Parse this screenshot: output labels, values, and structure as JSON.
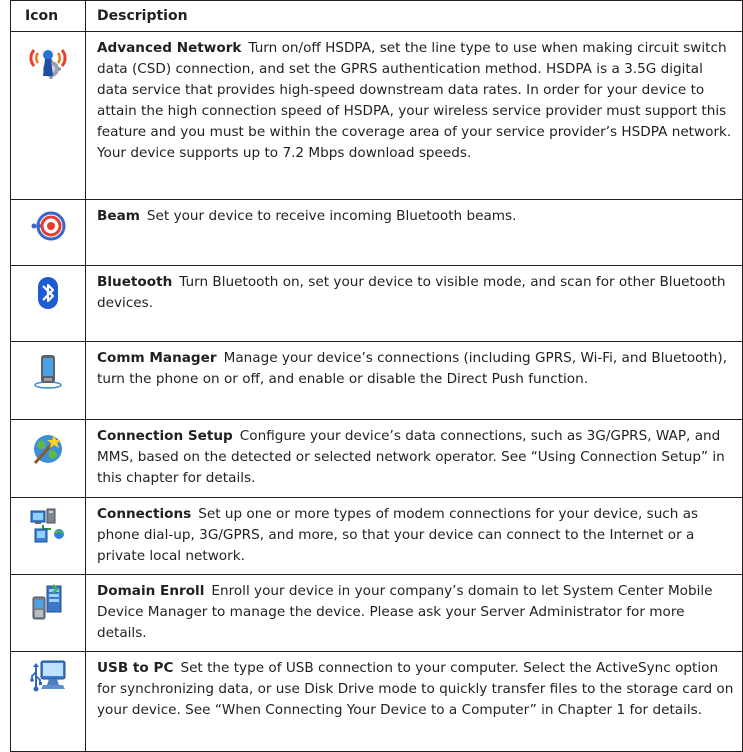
{
  "table": {
    "headers": {
      "icon": "Icon",
      "description": "Description"
    },
    "rows": [
      {
        "icon": "advanced-network-icon",
        "title": "Advanced Network",
        "text": "Turn on/off HSDPA, set the line type to use when making circuit switch data (CSD) connection, and set the GPRS authentication method. HSDPA is a 3.5G digital data service that provides high-speed downstream data rates. In order for your device to attain the high connection speed of HSDPA, your wireless service provider must support this feature and you must be within the coverage area of your service provider’s HSDPA network. Your device supports up to 7.2 Mbps download speeds."
      },
      {
        "icon": "beam-icon",
        "title": "Beam",
        "text": "Set your device to receive incoming Bluetooth beams."
      },
      {
        "icon": "bluetooth-icon",
        "title": "Bluetooth",
        "text": "Turn Bluetooth on, set your device to visible mode, and scan for other Bluetooth devices."
      },
      {
        "icon": "comm-manager-icon",
        "title": "Comm Manager",
        "text": "Manage your device’s connections (including GPRS, Wi-Fi, and Bluetooth), turn the phone on or off, and enable or disable the Direct Push function."
      },
      {
        "icon": "connection-setup-icon",
        "title": "Connection Setup",
        "text": "Configure your device’s data connections, such as 3G/GPRS, WAP, and MMS, based on the detected or selected network operator. See “Using Connection Setup” in this chapter for details."
      },
      {
        "icon": "connections-icon",
        "title": "Connections",
        "text": "Set up one or more types of modem connections for your device, such as phone dial-up, 3G/GPRS, and more, so that your device can connect to the Internet or a private local network."
      },
      {
        "icon": "domain-enroll-icon",
        "title": "Domain Enroll",
        "text": "Enroll your device in your company’s domain to let System Center Mobile Device Manager to manage the device. Please ask your Server Administrator for more details."
      },
      {
        "icon": "usb-to-pc-icon",
        "title": "USB to PC",
        "text": "Set the type of USB connection to your computer. Select the ActiveSync option for synchronizing data, or use Disk Drive mode to quickly transfer files to the storage card on your device. See “When Connecting Your Device to a Computer” in Chapter 1 for details."
      }
    ]
  }
}
